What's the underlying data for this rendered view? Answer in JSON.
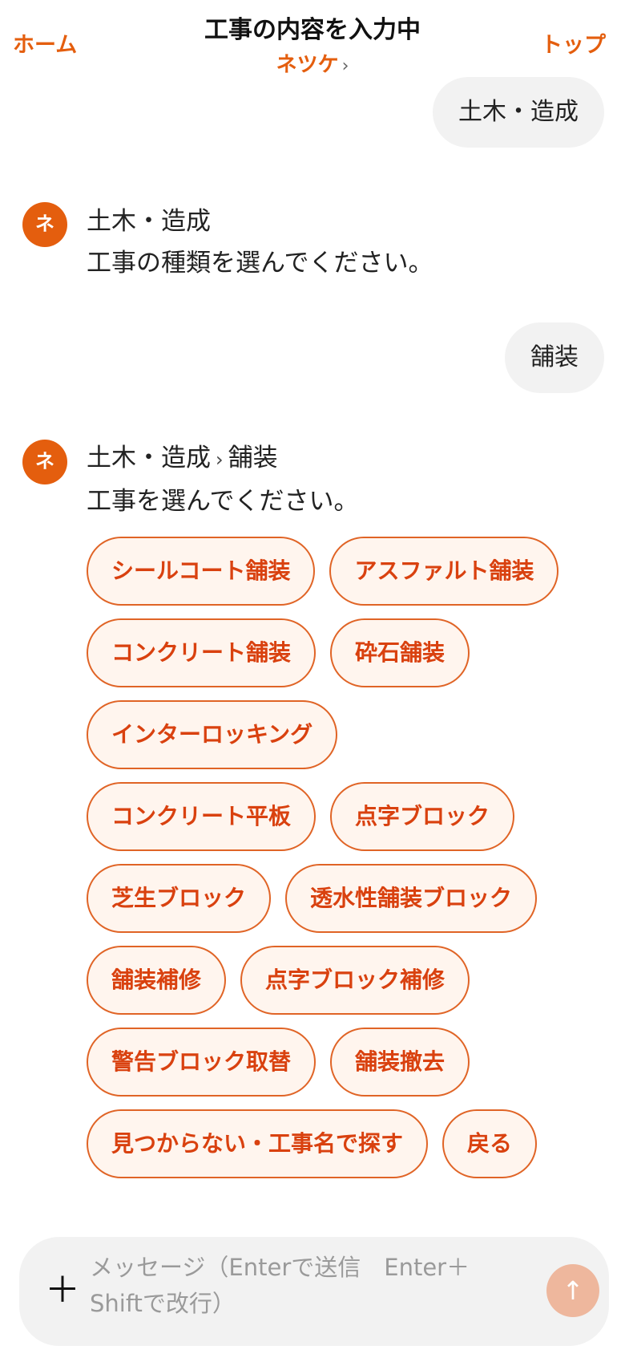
{
  "header": {
    "home_label": "ホーム",
    "top_label": "トップ",
    "title": "工事の内容を入力中",
    "subtitle": "ネツケ",
    "subtitle_chevron": "›"
  },
  "messages": {
    "user1": "土木・造成",
    "bot1": {
      "avatar": "ネ",
      "line1": "土木・造成",
      "line2": "工事の種類を選んでください。"
    },
    "user2": "舗装",
    "bot2": {
      "avatar": "ネ",
      "breadcrumb_parent": "土木・造成",
      "breadcrumb_sep": "›",
      "breadcrumb_child": "舗装",
      "line2": "工事を選んでください。"
    }
  },
  "options": [
    [
      "シールコート舗装",
      "アスファルト舗装"
    ],
    [
      "コンクリート舗装",
      "砕石舗装"
    ],
    [
      "インターロッキング"
    ],
    [
      "コンクリート平板",
      "点字ブロック"
    ],
    [
      "芝生ブロック",
      "透水性舗装ブロック"
    ],
    [
      "舗装補修",
      "点字ブロック補修"
    ],
    [
      "警告ブロック取替",
      "舗装撤去"
    ],
    [
      "見つからない・工事名で探す",
      "戻る"
    ]
  ],
  "composer": {
    "plus_icon": "＋",
    "placeholder": "メッセージ（Enterで送信　Enter＋Shiftで改行）",
    "send_icon": "↑"
  },
  "colors": {
    "accent": "#e45e0e",
    "chip_text": "#d9410f",
    "chip_bg": "#fff5ee",
    "bubble_bg": "#f2f2f2",
    "send_bg": "#eeb79d"
  }
}
